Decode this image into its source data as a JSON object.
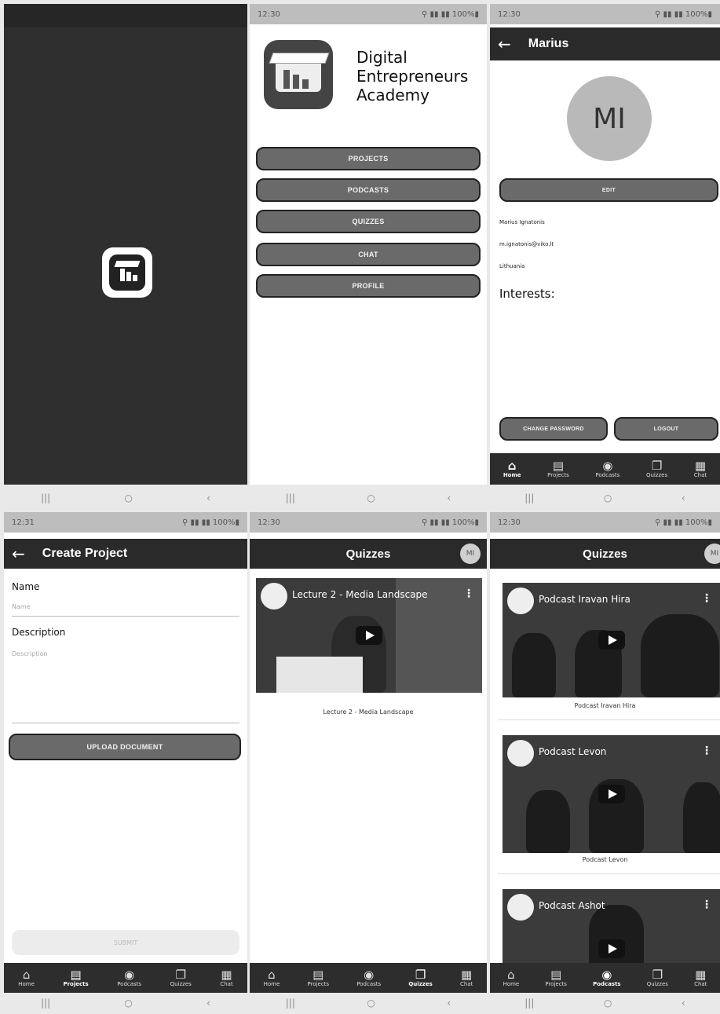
{
  "status": {
    "time_s2": "12:30",
    "icons_s2": "⚲ ▮▮ ▮▮ 100%▮",
    "time_s3": "12:30",
    "icons_s3": "⚲ ▮▮ ▮▮ 100%▮",
    "time_s4": "12:31",
    "icons_s4": "⚲ ▮▮ ▮▮ 100%▮",
    "time_s5": "12:30",
    "icons_s5": "⚲ ▮▮ ▮▮ 100%▮",
    "time_s6": "12:30",
    "icons_s6": "⚲ ▮▮ ▮▮ 100%▮"
  },
  "menu": {
    "app_name_line1": "Digital",
    "app_name_line2": "Entrepreneurs",
    "app_name_line3": "Academy",
    "buttons": [
      "PROJECTS",
      "PODCASTS",
      "QUIZZES",
      "CHAT",
      "PROFILE"
    ]
  },
  "profile": {
    "title": "Marius",
    "initials": "MI",
    "edit_label": "EDIT",
    "full_name": "Marius Ignatonis",
    "email": "m.ignatonis@viko.lt",
    "country": "Lithuania",
    "interests_label": "Interests:",
    "change_password_label": "CHANGE PASSWORD",
    "logout_label": "LOGOUT"
  },
  "create_project": {
    "title": "Create Project",
    "name_label": "Name",
    "name_placeholder": "Name",
    "description_label": "Description",
    "description_placeholder": "Description",
    "upload_label": "UPLOAD DOCUMENT",
    "submit_label": "SUBMIT"
  },
  "quizzes": {
    "title": "Quizzes",
    "avatar_initials": "MI",
    "video_title": "Lecture 2 - Media Landscape",
    "video_caption": "Lecture 2 - Media Landscape"
  },
  "podcasts_screen": {
    "title": "Quizzes",
    "avatar_initials": "MI",
    "videos": [
      {
        "title": "Podcast Iravan Hira",
        "caption": "Podcast Iravan Hira"
      },
      {
        "title": "Podcast Levon",
        "caption": "Podcast Levon"
      },
      {
        "title": "Podcast Ashot",
        "caption": ""
      }
    ]
  },
  "nav": {
    "home": "Home",
    "projects": "Projects",
    "podcasts": "Podcasts",
    "quizzes": "Quizzes",
    "chat": "Chat"
  },
  "sysnav": {
    "recents": "|||",
    "home": "○",
    "back": "‹"
  }
}
